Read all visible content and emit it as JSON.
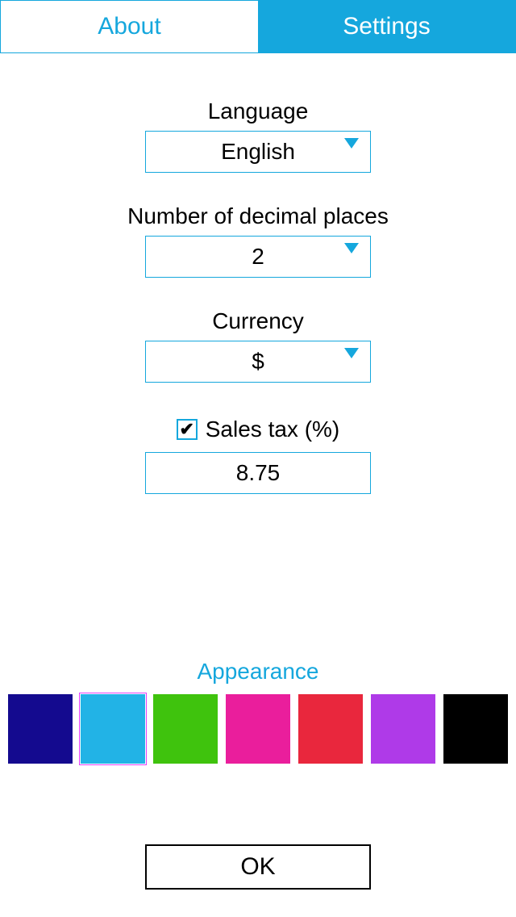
{
  "tabs": {
    "about": "About",
    "settings": "Settings"
  },
  "fields": {
    "language": {
      "label": "Language",
      "value": "English"
    },
    "decimals": {
      "label": "Number of decimal places",
      "value": "2"
    },
    "currency": {
      "label": "Currency",
      "value": "$"
    },
    "salesTax": {
      "label": "Sales tax (%)",
      "checked": "✔",
      "value": "8.75"
    }
  },
  "appearance": {
    "title": "Appearance",
    "colors": [
      "#140a8f",
      "#22b3e6",
      "#3fc30d",
      "#ea1e9c",
      "#e9273d",
      "#af3ae8",
      "#000000"
    ],
    "selectedIndex": 1
  },
  "buttons": {
    "ok": "OK"
  }
}
